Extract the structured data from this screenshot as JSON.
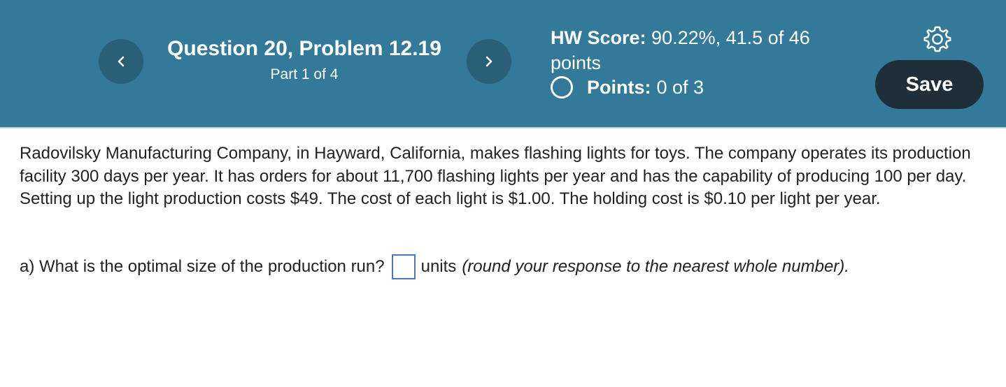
{
  "header": {
    "question_title": "Question 20, Problem 12.19",
    "part": "Part 1 of 4",
    "hw_score_label": "HW Score:",
    "hw_score_value": "90.22%, 41.5 of 46 points",
    "points_label": "Points:",
    "points_value": "0 of 3",
    "save_label": "Save",
    "prev_icon": "chevron-left-icon",
    "next_icon": "chevron-right-icon",
    "settings_icon": "gear-icon",
    "colors": {
      "header_bg": "#337999",
      "nav_bg": "#2a5f78",
      "save_bg": "#202e3a"
    }
  },
  "problem": {
    "text": "Radovilsky Manufacturing Company, in Hayward, California, makes flashing lights for toys. The company operates its production facility 300 days per year. It has orders for about 11,700 flashing lights per year and has the capability of producing 100 per day. Setting up the light production costs $49. The cost of each light is $1.00. The holding cost is $0.10 per light per year."
  },
  "part_a": {
    "question": "a) What is the optimal size of the production run?",
    "answer_value": "",
    "unit": "units",
    "hint": "(round your response to the nearest whole number)."
  }
}
